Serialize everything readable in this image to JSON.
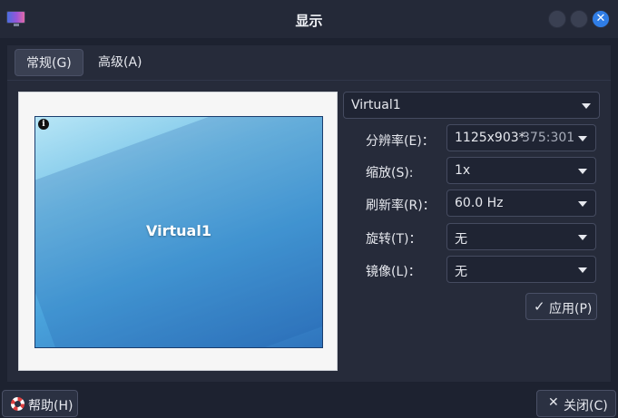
{
  "window": {
    "title": "显示",
    "app_icon": "display-settings-icon",
    "close_glyph": "✕"
  },
  "tabs": [
    {
      "label": "常规(G)",
      "active": true
    },
    {
      "label": "高级(A)",
      "active": false
    }
  ],
  "preview": {
    "monitor_label": "Virtual1",
    "info_glyph": "i"
  },
  "output_select": {
    "value": "Virtual1"
  },
  "fields": {
    "resolution": {
      "label": "分辨率(E)：",
      "value": "1125x903*",
      "ratio": "375:301"
    },
    "scale": {
      "label": "缩放(S):",
      "value": "1x"
    },
    "refresh": {
      "label": "刷新率(R)：",
      "value": "60.0 Hz"
    },
    "rotation": {
      "label": "旋转(T)：",
      "value": "无"
    },
    "mirror": {
      "label": "镜像(L)：",
      "value": "无"
    }
  },
  "buttons": {
    "apply": {
      "label": "应用(P)",
      "glyph": "✓"
    },
    "help": {
      "label": "帮助(H)"
    },
    "close": {
      "label": "关闭(C)",
      "glyph": "✕"
    }
  },
  "colors": {
    "accent": "#2f7de6",
    "background": "#1d2230",
    "panel": "#262b3a"
  }
}
